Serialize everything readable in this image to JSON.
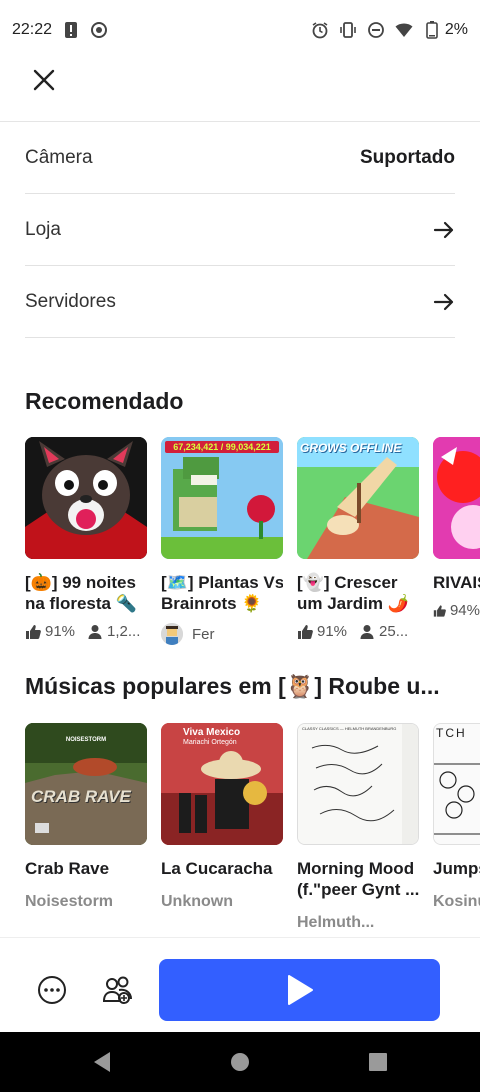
{
  "status_bar": {
    "time": "22:22",
    "battery": "2%"
  },
  "rows": [
    {
      "label": "Câmera",
      "value": "Suportado"
    },
    {
      "label": "Loja",
      "value": ""
    },
    {
      "label": "Servidores",
      "value": ""
    }
  ],
  "recommended": {
    "title": "Recomendado",
    "items": [
      {
        "title_line1": "[🎃] 99 noites",
        "title_line2": "na floresta 🔦",
        "likes": "91%",
        "players": "1,2..."
      },
      {
        "title_line1": "[🗺️] Plantas Vs",
        "title_line2": "Brainrots 🌻",
        "creator": "Fer",
        "thumb_text": "67,234,421 / 99,034,221"
      },
      {
        "title_line1": "[👻] Crescer",
        "title_line2": "um Jardim 🌶️",
        "likes": "91%",
        "players": "25...",
        "thumb_text": "GROWS OFFLINE"
      },
      {
        "title_line1": "RIVAIS",
        "title_line2": "",
        "likes": "94%"
      }
    ]
  },
  "music": {
    "title": "Músicas populares em [🦉] Roube u...",
    "items": [
      {
        "title_line1": "Crab Rave",
        "title_line2": "",
        "artist": "Noisestorm",
        "thumb_top": "NOISESTORM",
        "thumb_main": "CRAB RAVE"
      },
      {
        "title_line1": "La Cucaracha",
        "title_line2": "",
        "artist": "Unknown",
        "thumb_top": "Viva Mexico",
        "thumb_sub": "Mariachi Ortegón"
      },
      {
        "title_line1": "Morning Mood",
        "title_line2": "(f.\"peer Gynt ...",
        "artist": "Helmuth...",
        "thumb_top": "CLASSY CLASSICS — HELMUTH BRANDENBURG"
      },
      {
        "title_line1": "Jumps",
        "title_line2": "",
        "artist": "Kosinu",
        "thumb_top": "TCH"
      }
    ]
  },
  "colors": {
    "play_button": "#335fff",
    "text": "#1d1d1f",
    "muted": "#8a8a8a"
  },
  "icons": {
    "close": "close-icon",
    "arrow": "arrow-right-icon",
    "more": "more-icon",
    "party": "party-icon",
    "play": "play-icon"
  }
}
